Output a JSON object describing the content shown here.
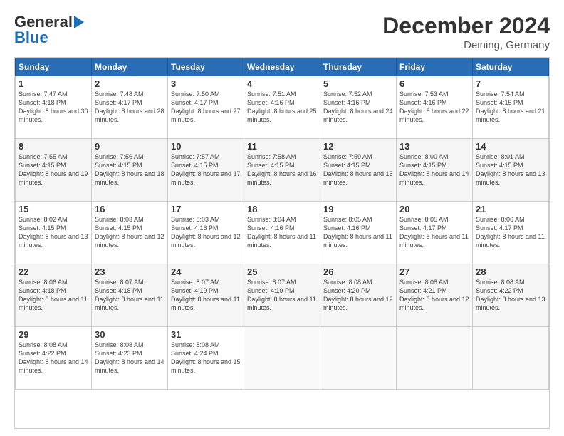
{
  "header": {
    "logo_line1": "General",
    "logo_line2": "Blue",
    "title": "December 2024",
    "subtitle": "Deining, Germany"
  },
  "calendar": {
    "days_of_week": [
      "Sunday",
      "Monday",
      "Tuesday",
      "Wednesday",
      "Thursday",
      "Friday",
      "Saturday"
    ],
    "weeks": [
      [
        null,
        {
          "day": 2,
          "sunrise": "7:48 AM",
          "sunset": "4:17 PM",
          "daylight": "8 hours and 28 minutes."
        },
        {
          "day": 3,
          "sunrise": "7:50 AM",
          "sunset": "4:17 PM",
          "daylight": "8 hours and 27 minutes."
        },
        {
          "day": 4,
          "sunrise": "7:51 AM",
          "sunset": "4:16 PM",
          "daylight": "8 hours and 25 minutes."
        },
        {
          "day": 5,
          "sunrise": "7:52 AM",
          "sunset": "4:16 PM",
          "daylight": "8 hours and 24 minutes."
        },
        {
          "day": 6,
          "sunrise": "7:53 AM",
          "sunset": "4:16 PM",
          "daylight": "8 hours and 22 minutes."
        },
        {
          "day": 7,
          "sunrise": "7:54 AM",
          "sunset": "4:15 PM",
          "daylight": "8 hours and 21 minutes."
        }
      ],
      [
        {
          "day": 8,
          "sunrise": "7:55 AM",
          "sunset": "4:15 PM",
          "daylight": "8 hours and 19 minutes."
        },
        {
          "day": 9,
          "sunrise": "7:56 AM",
          "sunset": "4:15 PM",
          "daylight": "8 hours and 18 minutes."
        },
        {
          "day": 10,
          "sunrise": "7:57 AM",
          "sunset": "4:15 PM",
          "daylight": "8 hours and 17 minutes."
        },
        {
          "day": 11,
          "sunrise": "7:58 AM",
          "sunset": "4:15 PM",
          "daylight": "8 hours and 16 minutes."
        },
        {
          "day": 12,
          "sunrise": "7:59 AM",
          "sunset": "4:15 PM",
          "daylight": "8 hours and 15 minutes."
        },
        {
          "day": 13,
          "sunrise": "8:00 AM",
          "sunset": "4:15 PM",
          "daylight": "8 hours and 14 minutes."
        },
        {
          "day": 14,
          "sunrise": "8:01 AM",
          "sunset": "4:15 PM",
          "daylight": "8 hours and 13 minutes."
        }
      ],
      [
        {
          "day": 15,
          "sunrise": "8:02 AM",
          "sunset": "4:15 PM",
          "daylight": "8 hours and 13 minutes."
        },
        {
          "day": 16,
          "sunrise": "8:03 AM",
          "sunset": "4:15 PM",
          "daylight": "8 hours and 12 minutes."
        },
        {
          "day": 17,
          "sunrise": "8:03 AM",
          "sunset": "4:16 PM",
          "daylight": "8 hours and 12 minutes."
        },
        {
          "day": 18,
          "sunrise": "8:04 AM",
          "sunset": "4:16 PM",
          "daylight": "8 hours and 11 minutes."
        },
        {
          "day": 19,
          "sunrise": "8:05 AM",
          "sunset": "4:16 PM",
          "daylight": "8 hours and 11 minutes."
        },
        {
          "day": 20,
          "sunrise": "8:05 AM",
          "sunset": "4:17 PM",
          "daylight": "8 hours and 11 minutes."
        },
        {
          "day": 21,
          "sunrise": "8:06 AM",
          "sunset": "4:17 PM",
          "daylight": "8 hours and 11 minutes."
        }
      ],
      [
        {
          "day": 22,
          "sunrise": "8:06 AM",
          "sunset": "4:18 PM",
          "daylight": "8 hours and 11 minutes."
        },
        {
          "day": 23,
          "sunrise": "8:07 AM",
          "sunset": "4:18 PM",
          "daylight": "8 hours and 11 minutes."
        },
        {
          "day": 24,
          "sunrise": "8:07 AM",
          "sunset": "4:19 PM",
          "daylight": "8 hours and 11 minutes."
        },
        {
          "day": 25,
          "sunrise": "8:07 AM",
          "sunset": "4:19 PM",
          "daylight": "8 hours and 11 minutes."
        },
        {
          "day": 26,
          "sunrise": "8:08 AM",
          "sunset": "4:20 PM",
          "daylight": "8 hours and 12 minutes."
        },
        {
          "day": 27,
          "sunrise": "8:08 AM",
          "sunset": "4:21 PM",
          "daylight": "8 hours and 12 minutes."
        },
        {
          "day": 28,
          "sunrise": "8:08 AM",
          "sunset": "4:22 PM",
          "daylight": "8 hours and 13 minutes."
        }
      ],
      [
        {
          "day": 29,
          "sunrise": "8:08 AM",
          "sunset": "4:22 PM",
          "daylight": "8 hours and 14 minutes."
        },
        {
          "day": 30,
          "sunrise": "8:08 AM",
          "sunset": "4:23 PM",
          "daylight": "8 hours and 14 minutes."
        },
        {
          "day": 31,
          "sunrise": "8:08 AM",
          "sunset": "4:24 PM",
          "daylight": "8 hours and 15 minutes."
        },
        null,
        null,
        null,
        null
      ]
    ],
    "week0_day1": {
      "day": 1,
      "sunrise": "7:47 AM",
      "sunset": "4:18 PM",
      "daylight": "8 hours and 30 minutes."
    }
  }
}
